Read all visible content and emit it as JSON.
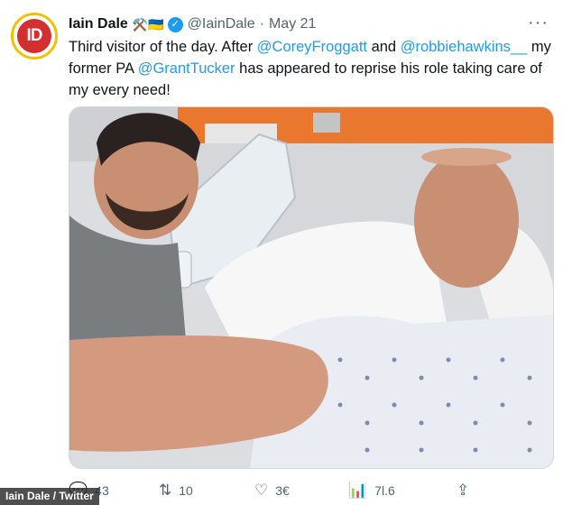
{
  "tweet": {
    "author_name": "Iain Dale",
    "author_emoji": "⚒️🇺🇦",
    "handle": "@IainDale",
    "separator": "·",
    "date": "May 21",
    "avatar_text": "ID",
    "text_parts": [
      {
        "type": "text",
        "value": "Third visitor of the day. After "
      },
      {
        "type": "mention",
        "value": "@CoreyFroggatt"
      },
      {
        "type": "text",
        "value": " and "
      },
      {
        "type": "mention",
        "value": "@robbiehawkins__"
      },
      {
        "type": "text",
        "value": " my former PA "
      },
      {
        "type": "mention",
        "value": "@GrantTucker"
      },
      {
        "type": "text",
        "value": " has appeared to reprise his role taking care of my every need!"
      }
    ]
  },
  "actions": {
    "reply_count": "43",
    "retweet_count": "10",
    "like_count": "3€",
    "views_count": "7l.6",
    "reply_icon": "reply-icon",
    "retweet_icon": "retweet-icon",
    "like_icon": "heart-icon",
    "views_icon": "views-icon",
    "share_icon": "share-icon"
  },
  "more_label": "···",
  "credit": "Iain Dale / Twitter",
  "colors": {
    "link": "#1d9bf0",
    "muted": "#536471",
    "wall_orange": "#e9772d",
    "gown_blue": "#3a4a8c"
  }
}
